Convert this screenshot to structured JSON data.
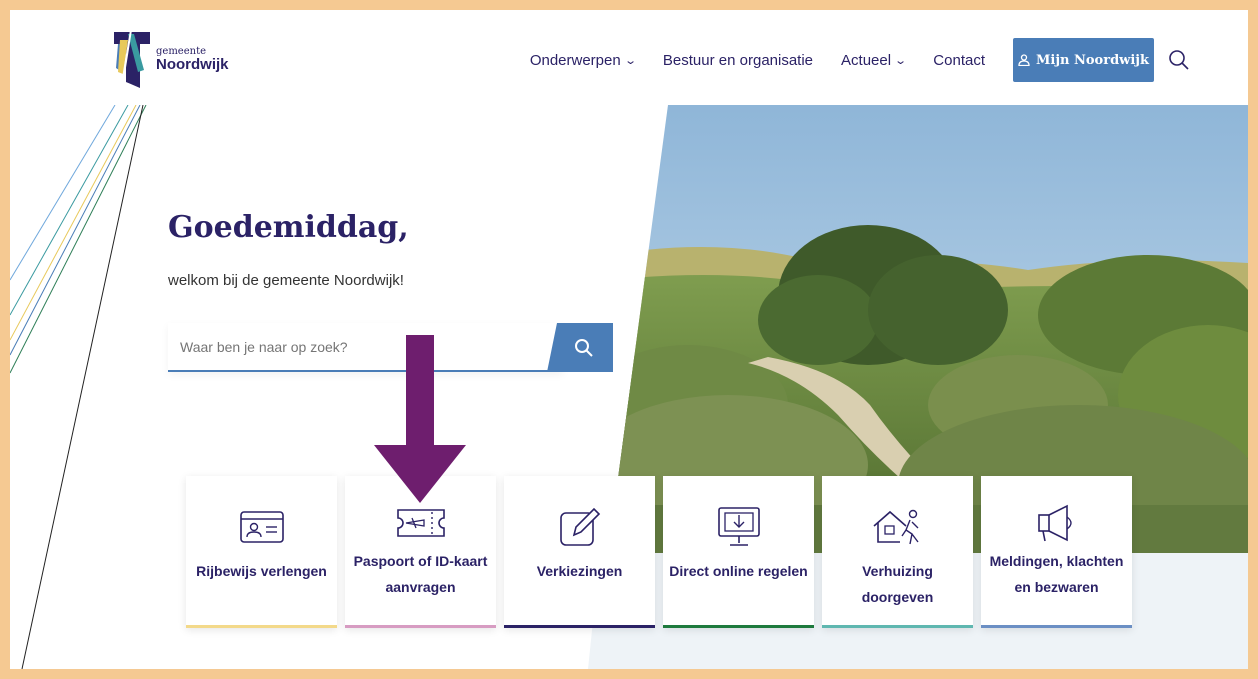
{
  "header": {
    "logo": {
      "small": "gemeente",
      "big": "Noordwijk"
    },
    "nav": [
      {
        "label": "Onderwerpen",
        "dropdown": true
      },
      {
        "label": "Bestuur en organisatie",
        "dropdown": false
      },
      {
        "label": "Actueel",
        "dropdown": true
      },
      {
        "label": "Contact",
        "dropdown": false
      }
    ],
    "account_button": "Mijn Noordwijk"
  },
  "hero": {
    "greeting": "Goedemiddag,",
    "welcome": "welkom bij de gemeente Noordwijk!",
    "search_placeholder": "Waar ben je naar op zoek?"
  },
  "cards": [
    {
      "label": "Rijbewijs verlengen",
      "icon": "id-card-icon",
      "color": "#f3d98a"
    },
    {
      "label": "Paspoort of ID-kaart aanvragen",
      "icon": "boarding-pass-icon",
      "color": "#d79cc2"
    },
    {
      "label": "Verkiezingen",
      "icon": "pencil-square-icon",
      "color": "#2b2266"
    },
    {
      "label": "Direct online regelen",
      "icon": "monitor-download-icon",
      "color": "#1e7a3d"
    },
    {
      "label": "Verhuizing doorgeven",
      "icon": "moving-house-icon",
      "color": "#5fb7b0"
    },
    {
      "label": "Meldingen, klachten en bezwaren",
      "icon": "megaphone-icon",
      "color": "#6b8fc4"
    }
  ],
  "colors": {
    "primary": "#2b2266",
    "accent": "#4a7db7",
    "frame": "#f5c992",
    "arrow": "#6e1e6e"
  }
}
